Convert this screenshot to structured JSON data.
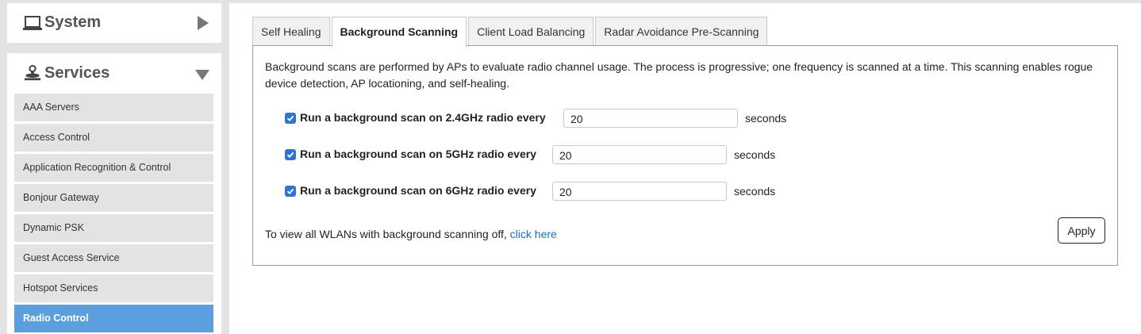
{
  "sidebar": {
    "system": {
      "label": "System",
      "icon": "laptop-icon"
    },
    "services": {
      "label": "Services",
      "icon": "services-icon",
      "items": [
        {
          "label": "AAA Servers"
        },
        {
          "label": "Access Control"
        },
        {
          "label": "Application Recognition & Control"
        },
        {
          "label": "Bonjour Gateway"
        },
        {
          "label": "Dynamic PSK"
        },
        {
          "label": "Guest Access Service"
        },
        {
          "label": "Hotspot Services"
        },
        {
          "label": "Radio Control"
        }
      ],
      "active_item": "Radio Control"
    },
    "active_color": "#5b9fdf"
  },
  "tabs": [
    {
      "label": "Self Healing"
    },
    {
      "label": "Background Scanning"
    },
    {
      "label": "Client Load Balancing"
    },
    {
      "label": "Radar Avoidance Pre-Scanning"
    }
  ],
  "active_tab": "Background Scanning",
  "content": {
    "description": "Background scans are performed by APs to evaluate radio channel usage. The process is progressive; one frequency is scanned at a time. This scanning enables rogue device detection, AP locationing, and self-healing.",
    "rows": [
      {
        "label": "Run a background scan on 2.4GHz radio every",
        "checked": true,
        "value": "20",
        "unit": "seconds"
      },
      {
        "label": "Run a background scan on 5GHz radio every",
        "checked": true,
        "value": "20",
        "unit": "seconds"
      },
      {
        "label": "Run a background scan on 6GHz radio every",
        "checked": true,
        "value": "20",
        "unit": "seconds"
      }
    ],
    "footer_text": "To view all WLANs with background scanning off,",
    "footer_link": "click here",
    "apply_label": "Apply"
  }
}
